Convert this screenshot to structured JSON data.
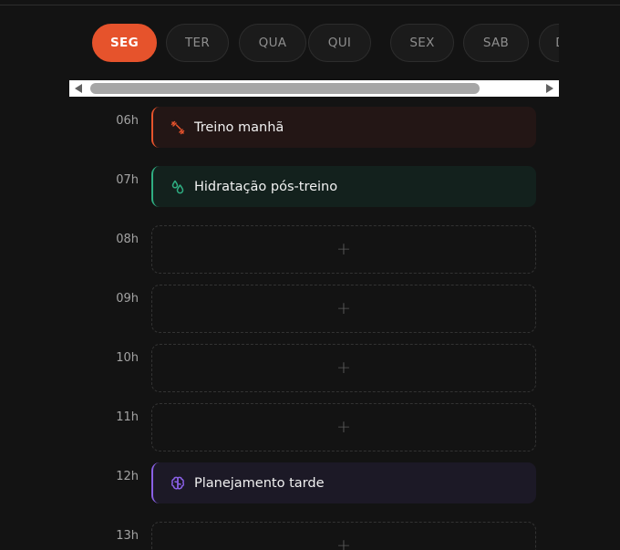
{
  "days": [
    {
      "label": "SEG",
      "active": true
    },
    {
      "label": "TER",
      "active": false
    },
    {
      "label": "QUA",
      "active": false
    },
    {
      "label": "QUI",
      "active": false
    },
    {
      "label": "SEX",
      "active": false
    },
    {
      "label": "SAB",
      "active": false
    },
    {
      "label": "DOM",
      "active": false
    }
  ],
  "schedule": [
    {
      "hour": "06h",
      "type": "event",
      "title": "Treino manhã",
      "icon": "dumbbell-icon",
      "accent": "#e6532c",
      "bg": "#231615"
    },
    {
      "hour": "07h",
      "type": "event",
      "title": "Hidratação pós-treino",
      "icon": "water-drops-icon",
      "accent": "#2fae82",
      "bg": "#13211d"
    },
    {
      "hour": "08h",
      "type": "empty",
      "add_symbol": "+"
    },
    {
      "hour": "09h",
      "type": "empty",
      "add_symbol": "+"
    },
    {
      "hour": "10h",
      "type": "empty",
      "add_symbol": "+"
    },
    {
      "hour": "11h",
      "type": "empty",
      "add_symbol": "+"
    },
    {
      "hour": "12h",
      "type": "event",
      "title": "Planejamento tarde",
      "icon": "brain-icon",
      "accent": "#8a60e6",
      "bg": "#1c1926"
    },
    {
      "hour": "13h",
      "type": "empty",
      "add_symbol": "+"
    }
  ]
}
